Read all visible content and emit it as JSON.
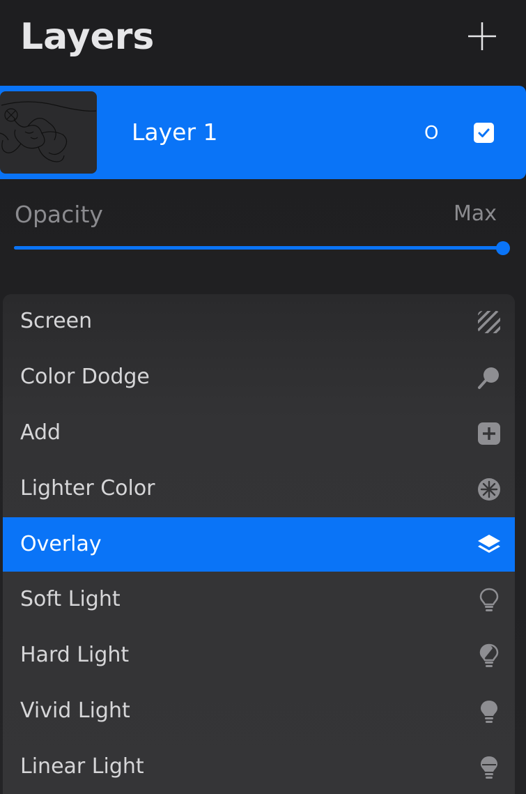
{
  "header": {
    "title": "Layers",
    "add_icon": "plus-icon"
  },
  "layer": {
    "name": "Layer 1",
    "blend_abbrev": "O",
    "visible": true,
    "thumbnail_icon": "sketch-thumbnail"
  },
  "opacity": {
    "label": "Opacity",
    "value_text": "Max",
    "level": 1.0
  },
  "blend_modes": [
    {
      "label": "Screen",
      "icon": "hatched-square-icon",
      "selected": false
    },
    {
      "label": "Color Dodge",
      "icon": "magnifier-icon",
      "selected": false
    },
    {
      "label": "Add",
      "icon": "plus-square-icon",
      "selected": false
    },
    {
      "label": "Lighter Color",
      "icon": "starburst-icon",
      "selected": false
    },
    {
      "label": "Overlay",
      "icon": "layers-stack-icon",
      "selected": true
    },
    {
      "label": "Soft Light",
      "icon": "bulb-outline-icon",
      "selected": false
    },
    {
      "label": "Hard Light",
      "icon": "bulb-half-icon",
      "selected": false
    },
    {
      "label": "Vivid Light",
      "icon": "bulb-filled-icon",
      "selected": false
    },
    {
      "label": "Linear Light",
      "icon": "bulb-lined-icon",
      "selected": false
    }
  ],
  "colors": {
    "accent": "#0a74f7",
    "background": "#1e1e20",
    "list_background": "#353537",
    "text_muted": "#8b8b8f"
  }
}
